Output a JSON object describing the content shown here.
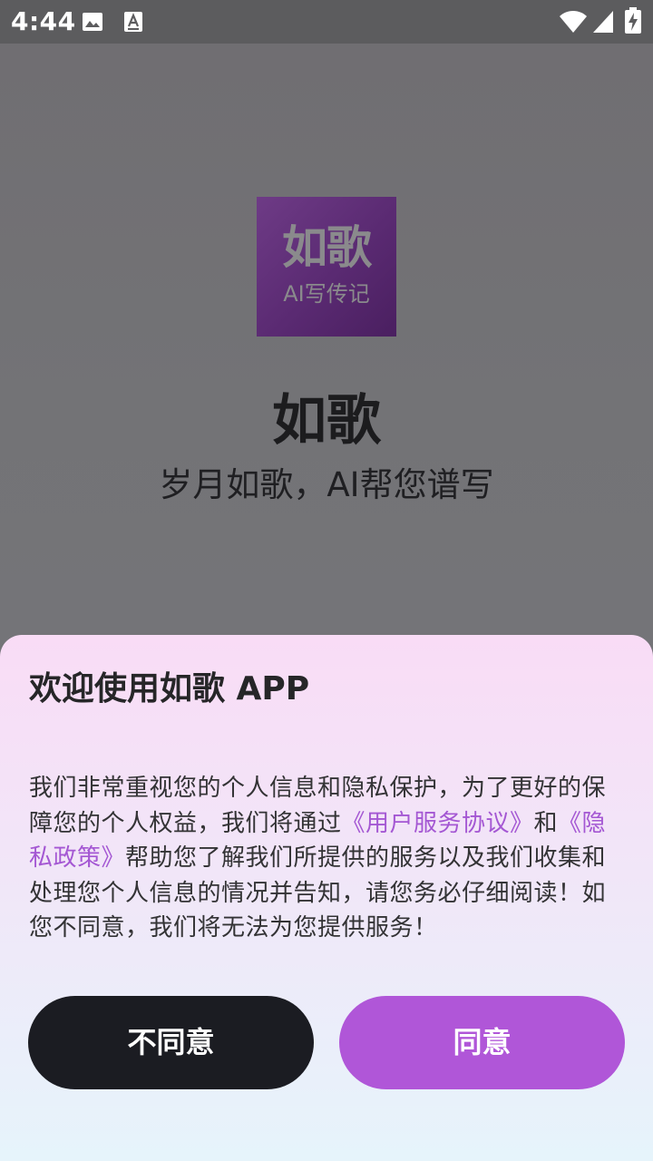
{
  "status_bar": {
    "time": "4:44",
    "icons": [
      "image-icon",
      "font-download-icon",
      "wifi-icon",
      "signal-icon",
      "battery-charging-icon"
    ]
  },
  "splash": {
    "logo_main": "如歌",
    "logo_sub": "AI写传记",
    "app_name": "如歌",
    "slogan": "岁月如歌，AI帮您谱写"
  },
  "dialog": {
    "title": "欢迎使用如歌 APP",
    "body_part1": "我们非常重视您的个人信息和隐私保护，为了更好的保障您的个人权益，我们将通过",
    "link_user_agreement": "《用户服务协议》",
    "body_and": "和",
    "link_privacy_policy": "《隐私政策》",
    "body_part2": "帮助您了解我们所提供的服务以及我们收集和处理您个人信息的情况并告知，请您务必仔细阅读！如您不同意，我们将无法为您提供服务！",
    "decline_label": "不同意",
    "agree_label": "同意"
  },
  "colors": {
    "accent": "#b056d8",
    "link": "#a457d3",
    "decline_button": "#1b1c22"
  }
}
